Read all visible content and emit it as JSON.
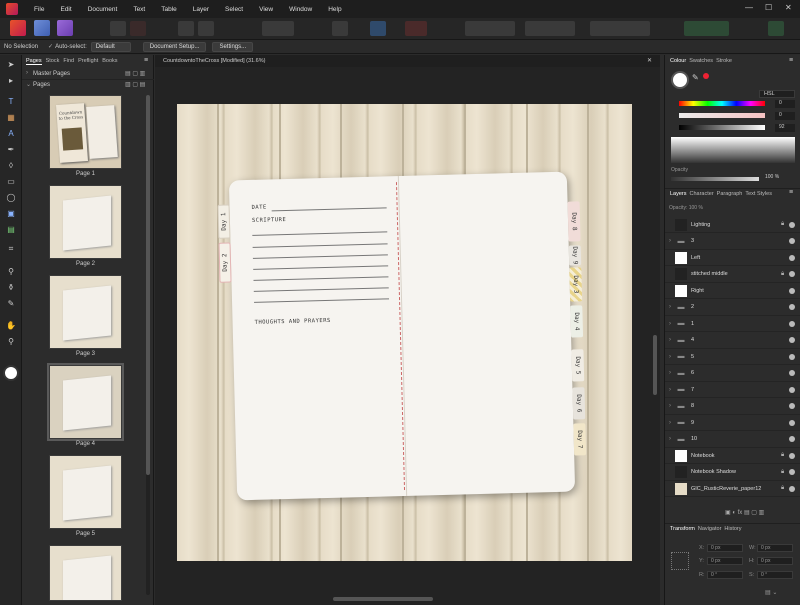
{
  "menu": [
    "File",
    "Edit",
    "Document",
    "Text",
    "Table",
    "Layer",
    "Select",
    "View",
    "Window",
    "Help"
  ],
  "context": {
    "no_selection": "No Selection",
    "auto_select": "Auto-select:",
    "auto_select_value": "Default",
    "doc_setup": "Document Setup...",
    "settings": "Settings..."
  },
  "pages_panel": {
    "tabs": [
      "Pages",
      "Stock",
      "Find",
      "Preflight",
      "Books"
    ],
    "master_pages": "Master Pages",
    "pages": "Pages",
    "labels": [
      "Page 1",
      "Page 2",
      "Page 3",
      "Page 4",
      "Page 5"
    ],
    "thumb_title": "Countdown to the Cross"
  },
  "document": {
    "tab_title": "CountdowntoTheCross [Modified] (31.6%)"
  },
  "notebook": {
    "date": "DATE",
    "scripture": "SCRIPTURE",
    "thoughts": "THOUGHTS AND PRAYERS",
    "left_tabs": [
      "Day 1",
      "Day 2"
    ],
    "right_tabs": [
      "Day 8",
      "Day 9",
      "Day 3",
      "Day 4",
      "Day 5",
      "Day 6",
      "Day 7"
    ]
  },
  "colour_panel": {
    "tabs": [
      "Colour",
      "Swatches",
      "Stroke"
    ],
    "mode": "HSL",
    "h": "0",
    "s": "0",
    "l": "92",
    "opacity_label": "Opacity",
    "opacity_value": "100 %"
  },
  "layers_panel": {
    "tabs": [
      "Layers",
      "Character",
      "Paragraph",
      "Text Styles"
    ],
    "opacity": "Opacity: 100 %",
    "layers": [
      {
        "name": "Lighting",
        "icon": "blank",
        "lock": true
      },
      {
        "name": "3",
        "icon": "folder",
        "lock": false
      },
      {
        "name": "Left",
        "icon": "white",
        "lock": false
      },
      {
        "name": "stitched middle",
        "icon": "blank",
        "lock": true
      },
      {
        "name": "Right",
        "icon": "white",
        "lock": false
      },
      {
        "name": "2",
        "icon": "folder",
        "lock": false
      },
      {
        "name": "1",
        "icon": "folder",
        "lock": false
      },
      {
        "name": "4",
        "icon": "folder",
        "lock": false
      },
      {
        "name": "5",
        "icon": "folder",
        "lock": false
      },
      {
        "name": "6",
        "icon": "folder",
        "lock": false
      },
      {
        "name": "7",
        "icon": "folder",
        "lock": false
      },
      {
        "name": "8",
        "icon": "folder",
        "lock": false
      },
      {
        "name": "9",
        "icon": "folder",
        "lock": false
      },
      {
        "name": "10",
        "icon": "folder",
        "lock": false
      },
      {
        "name": "Notebook",
        "icon": "white",
        "lock": true
      },
      {
        "name": "Notebook Shadow",
        "icon": "blank",
        "lock": true
      },
      {
        "name": "GIC_RusticReverie_paper12",
        "icon": "paper",
        "lock": true
      }
    ]
  },
  "transform_panel": {
    "tabs": [
      "Transform",
      "Navigator",
      "History"
    ],
    "x": "X:",
    "y": "Y:",
    "w": "W:",
    "h": "H:",
    "r": "R:",
    "s": "S:",
    "x_val": "0 px",
    "y_val": "0 px",
    "w_val": "0 px",
    "h_val": "0 px",
    "r_val": "0 °",
    "s_val": "0 °"
  }
}
